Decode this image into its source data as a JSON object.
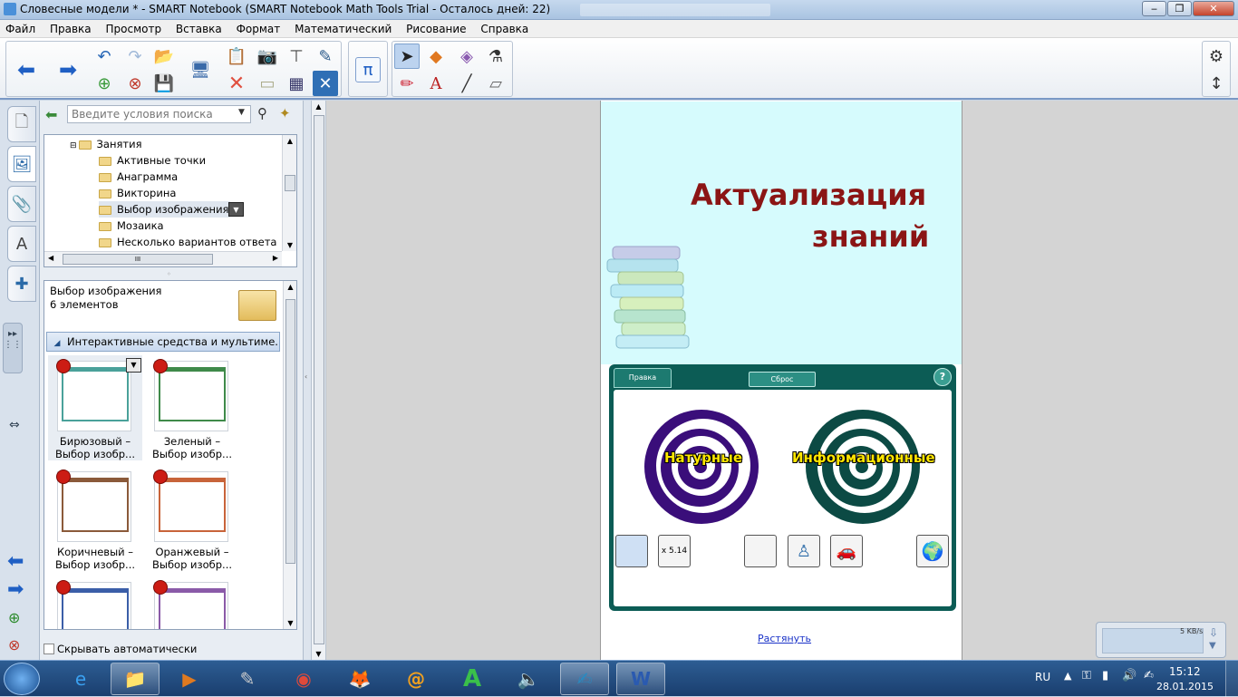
{
  "window": {
    "title": "Словесные модели * - SMART Notebook (SMART Notebook Math Tools Trial - Осталось дней: 22)"
  },
  "menu": [
    "Файл",
    "Правка",
    "Просмотр",
    "Вставка",
    "Формат",
    "Математический",
    "Рисование",
    "Справка"
  ],
  "toolbar": {
    "math_symbol": "π"
  },
  "gallery": {
    "search_placeholder": "Введите условия поиска",
    "tree": [
      "Занятия",
      "Активные точки",
      "Анаграмма",
      "Викторина",
      "Выбор изображения",
      "Мозаика",
      "Несколько вариантов ответа"
    ],
    "tree_scroll_symbol": "III",
    "info_title": "Выбор изображения",
    "info_count": "6 элементов",
    "category": "Интерактивные средства и мультиме...",
    "items": [
      {
        "line1": "Бирюзовый –",
        "line2": "Выбор изобр...",
        "color": "#4aa19a"
      },
      {
        "line1": "Зеленый –",
        "line2": "Выбор изобр...",
        "color": "#3f8a4a"
      },
      {
        "line1": "Коричневый –",
        "line2": "Выбор изобр...",
        "color": "#8b5a3a"
      },
      {
        "line1": "Оранжевый –",
        "line2": "Выбор изобр...",
        "color": "#c8643a"
      },
      {
        "line1": "",
        "line2": "",
        "color": "#3b5ea8"
      },
      {
        "line1": "",
        "line2": "",
        "color": "#8a5aa8"
      }
    ],
    "autohide_label": "Скрывать автоматически"
  },
  "slide": {
    "title_line1": "Актуализация",
    "title_line2": "знаний",
    "title_color": "#8b1515",
    "activity": {
      "tab_label": "Правка",
      "reset_label": "Сброс",
      "help_label": "?",
      "left_label": "Натурные",
      "right_label": "Информационные",
      "cards": [
        "",
        "x  5.14",
        "",
        "",
        "",
        ""
      ]
    },
    "stretch_link": "Растянуть"
  },
  "network_widget": {
    "speed": "5 KB/s"
  },
  "taskbar": {
    "lang": "RU",
    "time": "15:12",
    "date": "28.01.2015"
  }
}
